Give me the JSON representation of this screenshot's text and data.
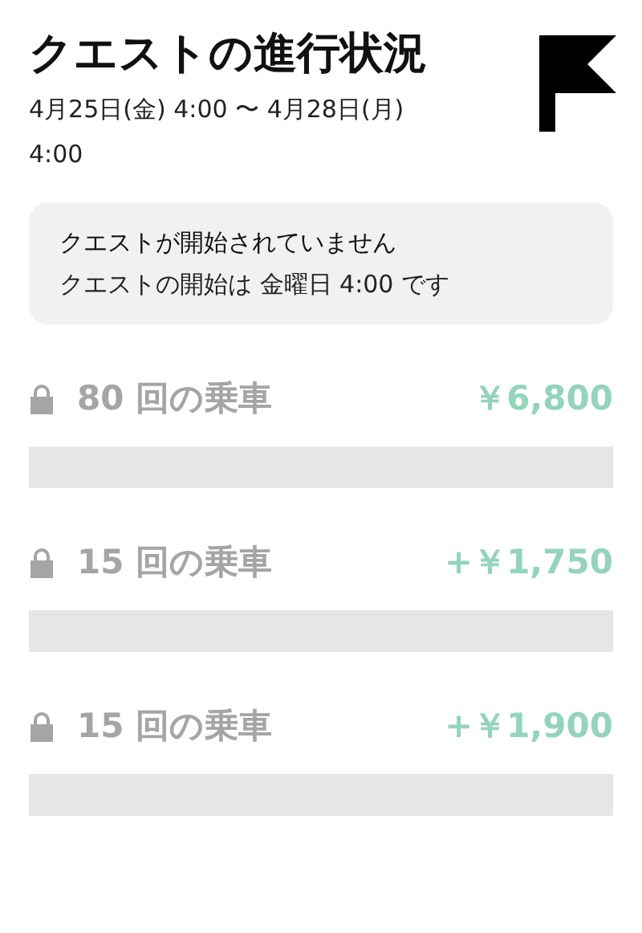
{
  "header": {
    "title": "クエストの進行状況",
    "date_range": "4月25日(金) 4:00 〜 4月28日(月) 4:00"
  },
  "notice": {
    "title": "クエストが開始されていません",
    "message": "クエストの開始は 金曜日 4:00 です"
  },
  "tiers": [
    {
      "label": "80 回の乗車",
      "reward": "￥6,800",
      "locked": true
    },
    {
      "label": "15 回の乗車",
      "reward": "+￥1,750",
      "locked": true
    },
    {
      "label": "15 回の乗車",
      "reward": "+￥1,900",
      "locked": true
    }
  ]
}
